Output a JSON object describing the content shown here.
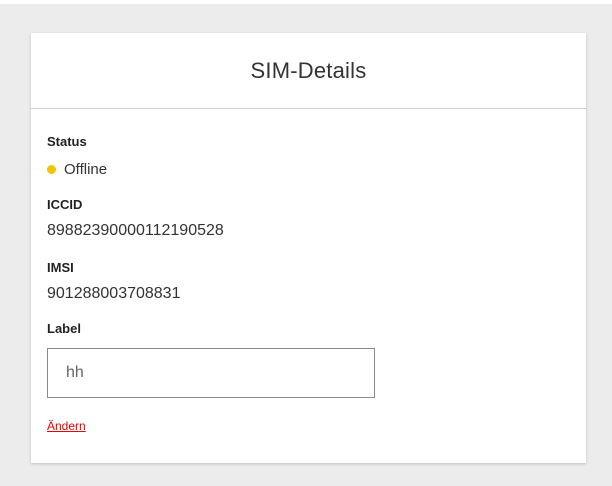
{
  "card": {
    "title": "SIM-Details"
  },
  "status": {
    "label": "Status",
    "value": "Offline",
    "indicator_color": "#f5c400",
    "indicator_icon": "status-dot-icon"
  },
  "iccid": {
    "label": "ICCID",
    "value": "89882390000112190528"
  },
  "imsi": {
    "label": "IMSI",
    "value": "901288003708831"
  },
  "label_field": {
    "label": "Label",
    "value": "hh"
  },
  "actions": {
    "change_label": "Ändern",
    "change_color": "#e60000"
  }
}
